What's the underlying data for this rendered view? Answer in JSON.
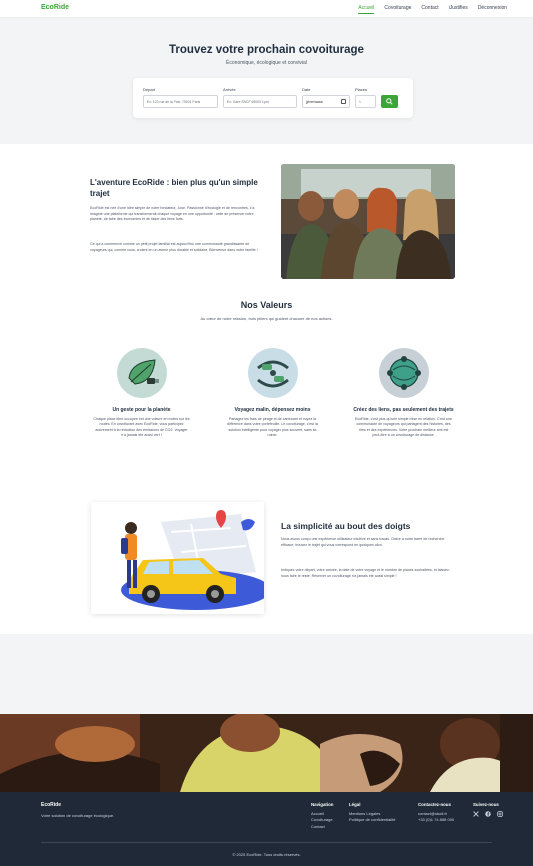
{
  "nav": {
    "brand": "EcoRide",
    "links": [
      "Accueil",
      "Covoiturage",
      "Contact",
      "iJustifies",
      "Déconnexion"
    ],
    "active_index": 0
  },
  "hero": {
    "title": "Trouvez votre prochain covoiturage",
    "subtitle": "Économique, écologique et convivial",
    "search": {
      "depart_label": "Départ",
      "depart_placeholder": "Ex: 123 rue de la Paix, 75001 Paris",
      "arrivee_label": "Arrivée",
      "arrivee_placeholder": "Ex: Gare SNCF 69000 Lyon",
      "date_label": "Date",
      "date_placeholder": "jj/mm/aaaa",
      "places_label": "Places",
      "places_value": "1"
    }
  },
  "story": {
    "title": "L'aventure EcoRide : bien plus qu'un simple trajet",
    "p1": "EcoRide est née d'une idée simple de notre fondateur, José. Passionné d'écologie et de rencontres, il a imaginé une plateforme qui transformerait chaque voyage en une opportunité : celle de préserver notre planète, de faire des économies et de tisser des liens forts.",
    "p2": "Ce qui a commencé comme un petit projet familial est aujourd'hui une communauté grandissante de voyageurs qui, comme vous, croient en un avenir plus durable et solidaire. Bienvenue dans notre famille !"
  },
  "values": {
    "title": "Nos Valeurs",
    "subtitle": "Au cœur de notre mission, trois piliers qui guident chacune de nos actions.",
    "items": [
      {
        "name": "Un geste pour la planète",
        "desc": "Chaque place libre occupée est une voiture en moins sur les routes. En covoiturant avec EcoRide, vous participez activement à la réduction des émissions de CO2. Voyager n'a jamais été aussi vert !",
        "icon": "leaf-plug-icon"
      },
      {
        "name": "Voyagez malin, dépensez moins",
        "desc": "Partagez les frais de péage et de carburant et voyez la différence dans votre portefeuille. Le covoiturage, c'est la solution intelligente pour voyager plus souvent, sans se ruiner.",
        "icon": "cars-road-icon"
      },
      {
        "name": "Créez des liens, pas seulement des trajets",
        "desc": "EcoRide, c'est plus qu'une simple mise en relation. C'est une communauté de voyageurs qui partagent des histoires, des rires et des expériences. Votre prochain meilleur ami est peut-être à un covoiturage de distance.",
        "icon": "community-globe-icon"
      }
    ]
  },
  "simple": {
    "title": "La simplicité au bout des doigts",
    "p1": "Nous avons conçu une expérience utilisateur intuitive et sans tracas. Grâce à notre barre de recherche efficace, trouvez le trajet qui vous correspond en quelques clics.",
    "p2": "Indiquez votre départ, votre arrivée, la date de votre voyage et le nombre de places souhaitées, et laissez-nous faire le reste. Réserver un covoiturage n'a jamais été aussi simple !"
  },
  "footer": {
    "brand": "EcoRide",
    "desc": "Votre solution de covoiturage écologique.",
    "nav_head": "Navigation",
    "nav_links": [
      "Accueil",
      "Covoiturage",
      "Contact"
    ],
    "legal_head": "Légal",
    "legal_links": [
      "Mentions Légales",
      "Politique de confidentialité"
    ],
    "contact_head": "Contactez-nous",
    "contact_email": "contact@studi.fr",
    "contact_phone": "+33 (0)1 74 888 000",
    "follow_head": "Suivez-nous",
    "social_icons": [
      "x-icon",
      "facebook-icon",
      "instagram-icon"
    ],
    "copyright": "© 2025 EcoRide. Tous droits réservés."
  },
  "colors": {
    "accent": "#3aa635",
    "footer_bg": "#1f2937",
    "hero_bg": "#f3f4f6"
  }
}
